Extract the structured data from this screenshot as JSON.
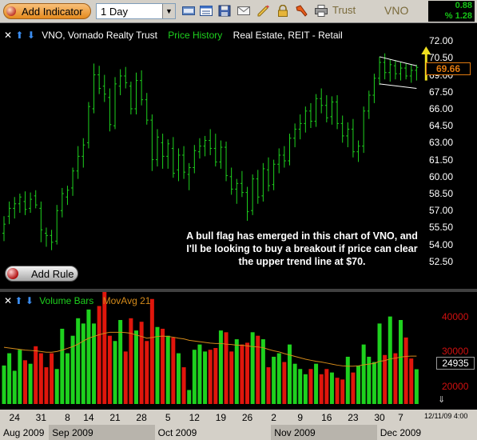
{
  "toolbar": {
    "add_indicator_label": "Add Indicator",
    "period_value": "1 Day",
    "trust_label": "Trust",
    "symbol_label": "VNO",
    "change": "0.88",
    "pct_change": "% 1.28",
    "icons": [
      "toggle-icon",
      "layout-icon",
      "save-icon",
      "mail-icon",
      "pencil-icon",
      "lock-icon",
      "tools-icon",
      "print-icon"
    ]
  },
  "price_panel": {
    "controls": [
      "✕",
      "⬆",
      "⬇"
    ],
    "title": "VNO, Vornado Realty Trust",
    "series_label": "Price History",
    "sector_label": "Real Estate, REIT - Retail",
    "last_price": "69.66",
    "annotation": "A bull flag has emerged in this chart of VNO, and I'll be looking to buy a breakout if price can clear the upper trend line at $70.",
    "add_rule_label": "Add Rule"
  },
  "volume_panel": {
    "controls": [
      "✕",
      "⬆",
      "⬇"
    ],
    "series_label": "Volume Bars",
    "ma_label": "MovAvg 21",
    "last_volume": "24935",
    "scroll_icon": "⇓"
  },
  "date_axis": {
    "day_ticks": [
      {
        "i": 2,
        "label": "24"
      },
      {
        "i": 7,
        "label": "31"
      },
      {
        "i": 12,
        "label": "8"
      },
      {
        "i": 16,
        "label": "14"
      },
      {
        "i": 21,
        "label": "21"
      },
      {
        "i": 26,
        "label": "28"
      },
      {
        "i": 31,
        "label": "5"
      },
      {
        "i": 36,
        "label": "12"
      },
      {
        "i": 41,
        "label": "19"
      },
      {
        "i": 46,
        "label": "26"
      },
      {
        "i": 51,
        "label": "2"
      },
      {
        "i": 56,
        "label": "9"
      },
      {
        "i": 61,
        "label": "16"
      },
      {
        "i": 66,
        "label": "23"
      },
      {
        "i": 71,
        "label": "30"
      },
      {
        "i": 75,
        "label": "7"
      }
    ],
    "months": [
      {
        "label": "Aug 2009",
        "start": 0,
        "end": 8
      },
      {
        "label": "Sep 2009",
        "start": 9,
        "end": 28
      },
      {
        "label": "Oct 2009",
        "start": 29,
        "end": 50
      },
      {
        "label": "Nov 2009",
        "start": 51,
        "end": 70
      },
      {
        "label": "Dec 2009",
        "start": 71,
        "end": 78
      }
    ],
    "timestamp": "12/11/09 4:00"
  },
  "colors": {
    "up": "#1ed11e",
    "down": "#e0160c",
    "ma": "#d48a1a",
    "arrow": "#f0e020",
    "axis_band": "#d4d0c8",
    "axis_band_alt": "#b8b4ac"
  },
  "chart_data": [
    {
      "type": "ohlc",
      "title": "VNO, Vornado Realty Trust",
      "series_name": "Price History",
      "ylim": [
        51.5,
        73.0
      ],
      "y_ticks": [
        "72.00",
        "70.50",
        "69.00",
        "67.50",
        "66.00",
        "64.50",
        "63.00",
        "61.50",
        "60.00",
        "58.50",
        "57.00",
        "55.50",
        "54.00",
        "52.50"
      ],
      "bars": [
        {
          "i": 0,
          "o": 55.0,
          "h": 56.5,
          "l": 54.3,
          "c": 55.8
        },
        {
          "i": 1,
          "o": 56.5,
          "h": 57.8,
          "l": 55.8,
          "c": 57.2
        },
        {
          "i": 2,
          "o": 57.2,
          "h": 58.2,
          "l": 56.3,
          "c": 57.6
        },
        {
          "i": 3,
          "o": 57.6,
          "h": 58.5,
          "l": 56.8,
          "c": 58.2
        },
        {
          "i": 4,
          "o": 57.8,
          "h": 58.7,
          "l": 56.6,
          "c": 57.1
        },
        {
          "i": 5,
          "o": 57.2,
          "h": 58.6,
          "l": 56.8,
          "c": 58.0
        },
        {
          "i": 6,
          "o": 58.3,
          "h": 58.8,
          "l": 57.2,
          "c": 57.5
        },
        {
          "i": 7,
          "o": 57.2,
          "h": 57.8,
          "l": 54.2,
          "c": 55.3
        },
        {
          "i": 8,
          "o": 55.0,
          "h": 55.5,
          "l": 53.8,
          "c": 54.8
        },
        {
          "i": 9,
          "o": 54.8,
          "h": 55.3,
          "l": 53.5,
          "c": 54.2
        },
        {
          "i": 10,
          "o": 54.3,
          "h": 57.5,
          "l": 54.0,
          "c": 57.0
        },
        {
          "i": 11,
          "o": 57.0,
          "h": 59.0,
          "l": 56.4,
          "c": 58.5
        },
        {
          "i": 12,
          "o": 58.2,
          "h": 59.2,
          "l": 57.5,
          "c": 58.8
        },
        {
          "i": 13,
          "o": 59.0,
          "h": 60.8,
          "l": 58.3,
          "c": 60.5
        },
        {
          "i": 14,
          "o": 60.5,
          "h": 62.7,
          "l": 59.8,
          "c": 61.8
        },
        {
          "i": 15,
          "o": 61.8,
          "h": 63.4,
          "l": 60.8,
          "c": 62.8
        },
        {
          "i": 16,
          "o": 63.0,
          "h": 66.6,
          "l": 62.5,
          "c": 66.2
        },
        {
          "i": 17,
          "o": 66.0,
          "h": 70.0,
          "l": 65.6,
          "c": 69.0
        },
        {
          "i": 18,
          "o": 69.0,
          "h": 69.8,
          "l": 67.3,
          "c": 67.8
        },
        {
          "i": 19,
          "o": 68.0,
          "h": 69.0,
          "l": 66.6,
          "c": 67.3
        },
        {
          "i": 20,
          "o": 67.0,
          "h": 67.8,
          "l": 64.0,
          "c": 64.6
        },
        {
          "i": 21,
          "o": 64.5,
          "h": 68.8,
          "l": 64.2,
          "c": 68.2
        },
        {
          "i": 22,
          "o": 68.0,
          "h": 69.5,
          "l": 67.2,
          "c": 68.9
        },
        {
          "i": 23,
          "o": 68.9,
          "h": 69.7,
          "l": 67.8,
          "c": 68.3
        },
        {
          "i": 24,
          "o": 68.0,
          "h": 68.4,
          "l": 65.5,
          "c": 66.0
        },
        {
          "i": 25,
          "o": 66.0,
          "h": 69.2,
          "l": 65.5,
          "c": 68.5
        },
        {
          "i": 26,
          "o": 68.5,
          "h": 69.4,
          "l": 66.3,
          "c": 66.8
        },
        {
          "i": 27,
          "o": 66.8,
          "h": 67.4,
          "l": 64.6,
          "c": 65.0
        },
        {
          "i": 28,
          "o": 65.0,
          "h": 65.5,
          "l": 60.5,
          "c": 61.5
        },
        {
          "i": 29,
          "o": 61.5,
          "h": 64.2,
          "l": 60.9,
          "c": 63.5
        },
        {
          "i": 30,
          "o": 63.0,
          "h": 63.8,
          "l": 60.7,
          "c": 61.8
        },
        {
          "i": 31,
          "o": 61.8,
          "h": 63.3,
          "l": 60.7,
          "c": 62.9
        },
        {
          "i": 32,
          "o": 62.5,
          "h": 63.5,
          "l": 59.9,
          "c": 60.3
        },
        {
          "i": 33,
          "o": 60.6,
          "h": 62.5,
          "l": 59.6,
          "c": 61.9
        },
        {
          "i": 34,
          "o": 61.9,
          "h": 62.7,
          "l": 59.8,
          "c": 60.4
        },
        {
          "i": 35,
          "o": 60.2,
          "h": 61.2,
          "l": 58.8,
          "c": 60.8
        },
        {
          "i": 36,
          "o": 60.8,
          "h": 62.8,
          "l": 60.3,
          "c": 62.3
        },
        {
          "i": 37,
          "o": 62.2,
          "h": 63.4,
          "l": 61.6,
          "c": 62.7
        },
        {
          "i": 38,
          "o": 62.7,
          "h": 63.6,
          "l": 61.8,
          "c": 63.2
        },
        {
          "i": 39,
          "o": 63.2,
          "h": 64.2,
          "l": 61.9,
          "c": 62.5
        },
        {
          "i": 40,
          "o": 62.5,
          "h": 63.8,
          "l": 60.9,
          "c": 61.3
        },
        {
          "i": 41,
          "o": 61.3,
          "h": 63.2,
          "l": 60.7,
          "c": 62.6
        },
        {
          "i": 42,
          "o": 62.6,
          "h": 63.1,
          "l": 59.6,
          "c": 60.1
        },
        {
          "i": 43,
          "o": 60.0,
          "h": 60.8,
          "l": 58.4,
          "c": 58.9
        },
        {
          "i": 44,
          "o": 58.9,
          "h": 59.8,
          "l": 57.6,
          "c": 59.4
        },
        {
          "i": 45,
          "o": 59.4,
          "h": 60.5,
          "l": 58.2,
          "c": 58.6
        },
        {
          "i": 46,
          "o": 58.6,
          "h": 59.1,
          "l": 56.1,
          "c": 56.9
        },
        {
          "i": 47,
          "o": 57.0,
          "h": 60.2,
          "l": 56.6,
          "c": 59.8
        },
        {
          "i": 48,
          "o": 59.8,
          "h": 60.6,
          "l": 57.6,
          "c": 58.2
        },
        {
          "i": 49,
          "o": 58.3,
          "h": 61.2,
          "l": 57.8,
          "c": 60.7
        },
        {
          "i": 50,
          "o": 60.6,
          "h": 61.7,
          "l": 58.7,
          "c": 59.2
        },
        {
          "i": 51,
          "o": 59.3,
          "h": 61.5,
          "l": 58.8,
          "c": 61.1
        },
        {
          "i": 52,
          "o": 61.1,
          "h": 62.5,
          "l": 60.3,
          "c": 61.9
        },
        {
          "i": 53,
          "o": 61.9,
          "h": 62.7,
          "l": 60.8,
          "c": 61.4
        },
        {
          "i": 54,
          "o": 61.4,
          "h": 63.8,
          "l": 61.0,
          "c": 63.4
        },
        {
          "i": 55,
          "o": 63.4,
          "h": 64.7,
          "l": 62.6,
          "c": 64.2
        },
        {
          "i": 56,
          "o": 64.2,
          "h": 65.5,
          "l": 63.3,
          "c": 64.7
        },
        {
          "i": 57,
          "o": 64.7,
          "h": 66.2,
          "l": 63.9,
          "c": 65.8
        },
        {
          "i": 58,
          "o": 65.8,
          "h": 66.5,
          "l": 64.3,
          "c": 64.9
        },
        {
          "i": 59,
          "o": 64.9,
          "h": 67.3,
          "l": 64.4,
          "c": 66.9
        },
        {
          "i": 60,
          "o": 66.9,
          "h": 67.8,
          "l": 65.6,
          "c": 66.3
        },
        {
          "i": 61,
          "o": 66.3,
          "h": 67.2,
          "l": 64.8,
          "c": 65.2
        },
        {
          "i": 62,
          "o": 65.3,
          "h": 67.1,
          "l": 64.6,
          "c": 66.6
        },
        {
          "i": 63,
          "o": 66.6,
          "h": 67.2,
          "l": 64.2,
          "c": 64.7
        },
        {
          "i": 64,
          "o": 64.7,
          "h": 65.4,
          "l": 63.0,
          "c": 63.6
        },
        {
          "i": 65,
          "o": 63.6,
          "h": 64.8,
          "l": 62.6,
          "c": 64.2
        },
        {
          "i": 66,
          "o": 64.2,
          "h": 65.1,
          "l": 61.7,
          "c": 62.2
        },
        {
          "i": 67,
          "o": 62.2,
          "h": 63.2,
          "l": 61.3,
          "c": 62.7
        },
        {
          "i": 68,
          "o": 62.7,
          "h": 66.2,
          "l": 62.1,
          "c": 65.8
        },
        {
          "i": 69,
          "o": 65.8,
          "h": 67.6,
          "l": 65.1,
          "c": 67.2
        },
        {
          "i": 70,
          "o": 67.2,
          "h": 69.1,
          "l": 66.5,
          "c": 68.7
        },
        {
          "i": 71,
          "o": 68.7,
          "h": 70.6,
          "l": 68.1,
          "c": 70.1
        },
        {
          "i": 72,
          "o": 70.1,
          "h": 70.9,
          "l": 68.6,
          "c": 69.2
        },
        {
          "i": 73,
          "o": 69.2,
          "h": 70.4,
          "l": 68.4,
          "c": 69.9
        },
        {
          "i": 74,
          "o": 69.8,
          "h": 70.3,
          "l": 68.6,
          "c": 69.1
        },
        {
          "i": 75,
          "o": 69.1,
          "h": 70.1,
          "l": 68.5,
          "c": 69.6
        },
        {
          "i": 76,
          "o": 69.6,
          "h": 70.0,
          "l": 68.6,
          "c": 68.9
        },
        {
          "i": 77,
          "o": 68.9,
          "h": 69.9,
          "l": 68.3,
          "c": 69.4
        },
        {
          "i": 78,
          "o": 69.4,
          "h": 69.9,
          "l": 68.5,
          "c": 69.66
        }
      ],
      "trendlines": [
        {
          "name": "flag-upper",
          "x1": 71,
          "y1": 70.6,
          "x2": 78,
          "y2": 69.8
        },
        {
          "name": "flag-lower",
          "x1": 71,
          "y1": 68.2,
          "x2": 78,
          "y2": 67.8
        }
      ],
      "breakout_arrow": {
        "x": 79.8,
        "y_from": 68.5,
        "y_to": 71.3
      }
    },
    {
      "type": "bar",
      "series_name": "Volume Bars",
      "ylim": [
        15000,
        47000
      ],
      "y_ticks": [
        "40000",
        "30000",
        "20000",
        "10000"
      ],
      "values": [
        26000,
        29500,
        24500,
        30500,
        27500,
        26500,
        31500,
        29500,
        25500,
        29500,
        25000,
        36500,
        29500,
        34500,
        39500,
        38000,
        42000,
        38000,
        43000,
        47000,
        34500,
        33000,
        39000,
        30000,
        39500,
        36000,
        38500,
        33000,
        45000,
        37000,
        36500,
        34500,
        34000,
        29500,
        25500,
        19000,
        30500,
        32000,
        30000,
        30500,
        31000,
        36000,
        35500,
        30000,
        33500,
        32000,
        32500,
        35500,
        34500,
        33500,
        25500,
        28500,
        29500,
        27000,
        32000,
        26500,
        25000,
        23500,
        25000,
        26500,
        23500,
        25000,
        24000,
        22500,
        22000,
        28500,
        24000,
        26000,
        32000,
        28500,
        27000,
        38000,
        29000,
        40000,
        29500,
        39000,
        34000,
        28000,
        24935
      ],
      "up": [
        true,
        true,
        true,
        true,
        false,
        true,
        false,
        false,
        false,
        false,
        true,
        true,
        true,
        true,
        true,
        true,
        true,
        true,
        false,
        false,
        false,
        true,
        true,
        false,
        false,
        true,
        false,
        false,
        false,
        true,
        false,
        true,
        false,
        true,
        false,
        true,
        true,
        true,
        true,
        false,
        false,
        true,
        false,
        false,
        true,
        false,
        false,
        true,
        false,
        true,
        false,
        true,
        true,
        false,
        true,
        true,
        true,
        true,
        false,
        true,
        false,
        false,
        true,
        false,
        false,
        true,
        false,
        true,
        true,
        true,
        true,
        true,
        false,
        true,
        false,
        true,
        false,
        false,
        true
      ],
      "moving_average_21": [
        31200,
        31000,
        30800,
        30600,
        30400,
        30300,
        30200,
        30000,
        29800,
        29800,
        30000,
        30400,
        30900,
        31400,
        32100,
        33000,
        33800,
        34300,
        34800,
        35200,
        35500,
        35500,
        35500,
        35400,
        35200,
        34700,
        34300,
        33800,
        34000,
        34300,
        34400,
        34300,
        34100,
        33800,
        33600,
        33200,
        33000,
        32800,
        32600,
        32400,
        32300,
        32300,
        32100,
        32000,
        31800,
        31800,
        31600,
        31400,
        31300,
        31100,
        30600,
        30200,
        29900,
        29400,
        29000,
        28600,
        28200,
        27800,
        27500,
        27200,
        27000,
        26700,
        26400,
        26100,
        25900,
        25800,
        25800,
        25900,
        26200,
        26400,
        26600,
        27200,
        27400,
        27900,
        28100,
        28400,
        28600,
        28700,
        28700
      ]
    }
  ]
}
